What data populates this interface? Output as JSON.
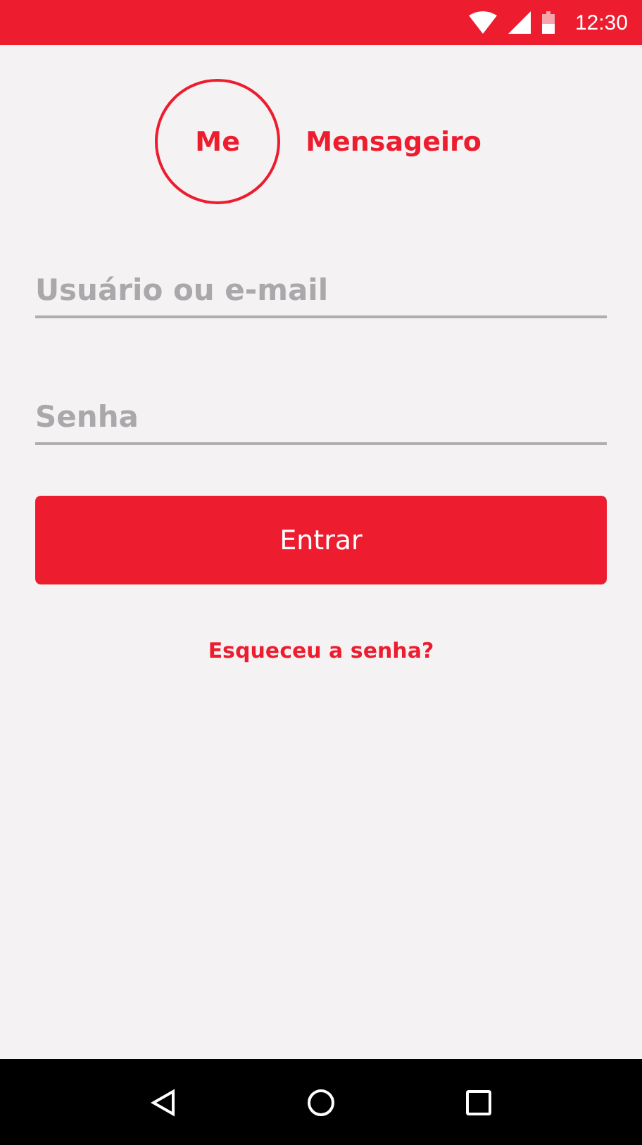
{
  "status_bar": {
    "time": "12:30"
  },
  "logo": {
    "mark": "Me",
    "name": "Mensageiro"
  },
  "fields": [
    {
      "placeholder": "Usuário ou e-mail"
    },
    {
      "placeholder": "Senha"
    }
  ],
  "submit": {
    "label": "Entrar"
  },
  "forgot_link": {
    "label": "Esqueceu a senha?"
  }
}
